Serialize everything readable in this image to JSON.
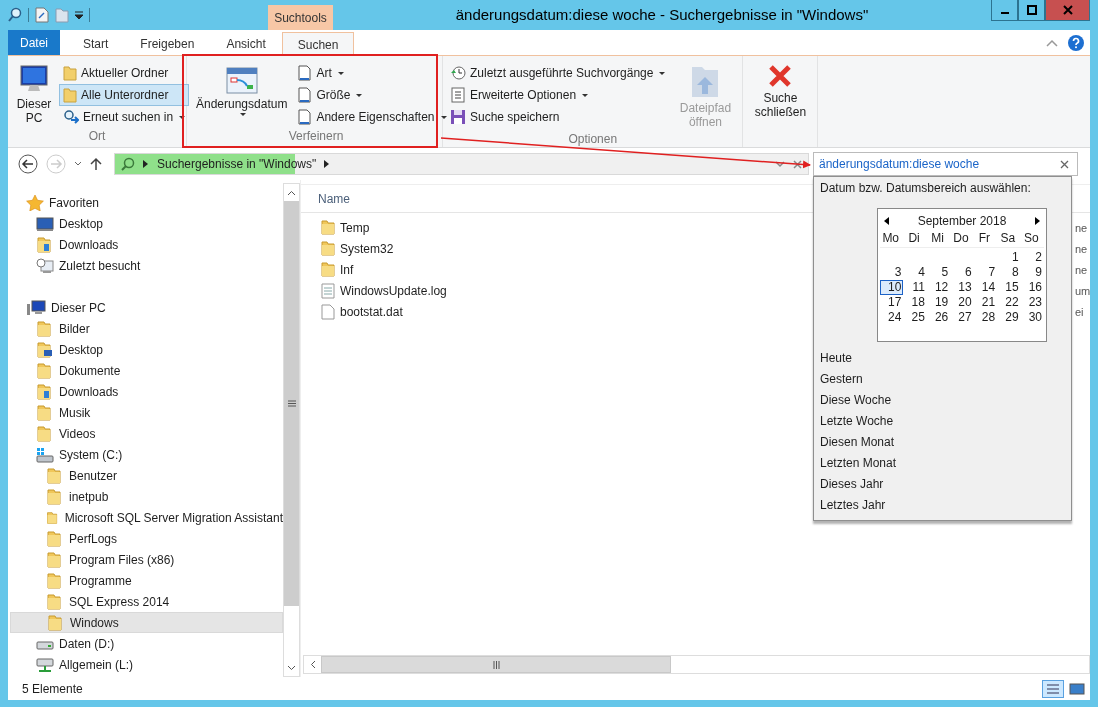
{
  "window": {
    "title": "änderungsdatum:diese woche - Suchergebnisse in \"Windows\""
  },
  "contextual_tab_group": "Suchtools",
  "ribbon_tabs": [
    {
      "label": "Datei",
      "kind": "file",
      "selected": false
    },
    {
      "label": "Start",
      "kind": "tab",
      "selected": false
    },
    {
      "label": "Freigeben",
      "kind": "tab",
      "selected": false
    },
    {
      "label": "Ansicht",
      "kind": "tab",
      "selected": false
    },
    {
      "label": "Suchen",
      "kind": "tab",
      "selected": true
    }
  ],
  "ribbon": {
    "ort": {
      "label": "Ort",
      "this_pc": "Dieser PC",
      "options": [
        {
          "label": "Aktueller Ordner",
          "selected": false
        },
        {
          "label": "Alle Unterordner",
          "selected": true
        }
      ],
      "search_again": "Erneut suchen in"
    },
    "verfeinern": {
      "label": "Verfeinern",
      "date_modified": "Änderungsdatum",
      "menus": [
        "Art",
        "Größe",
        "Andere Eigenschaften"
      ]
    },
    "optionen": {
      "label": "Optionen",
      "items": [
        {
          "label": "Zuletzt ausgeführte Suchvorgänge",
          "dropdown": true
        },
        {
          "label": "Erweiterte Optionen",
          "dropdown": true
        },
        {
          "label": "Suche speichern",
          "dropdown": false
        }
      ],
      "open_location": {
        "label": "Dateipfad öffnen",
        "disabled": true
      }
    },
    "close_search": "Suche schließen"
  },
  "address": {
    "location": "Suchergebnisse in \"Windows\"",
    "progress": {
      "level": 0.26
    }
  },
  "search": {
    "value": "änderungsdatum:diese woche"
  },
  "navigation": [
    {
      "label": "Favoriten",
      "kind": "favorites",
      "selected": false,
      "children": [
        {
          "label": "Desktop",
          "kind": "desktop",
          "selected": false
        },
        {
          "label": "Downloads",
          "kind": "downloads",
          "selected": false
        },
        {
          "label": "Zuletzt besucht",
          "kind": "recent",
          "selected": false
        }
      ]
    },
    {
      "label": "Dieser PC",
      "kind": "pc",
      "selected": false,
      "children": [
        {
          "label": "Bilder",
          "kind": "folder",
          "selected": false
        },
        {
          "label": "Desktop",
          "kind": "desktop-folder",
          "selected": false
        },
        {
          "label": "Dokumente",
          "kind": "folder",
          "selected": false
        },
        {
          "label": "Downloads",
          "kind": "downloads",
          "selected": false
        },
        {
          "label": "Musik",
          "kind": "folder",
          "selected": false
        },
        {
          "label": "Videos",
          "kind": "folder",
          "selected": false
        },
        {
          "label": "System (C:)",
          "kind": "system-drive",
          "selected": false,
          "children": [
            {
              "label": "Benutzer",
              "kind": "folder",
              "selected": false
            },
            {
              "label": "inetpub",
              "kind": "folder",
              "selected": false
            },
            {
              "label": "Microsoft SQL Server Migration Assistant",
              "kind": "folder",
              "selected": false
            },
            {
              "label": "PerfLogs",
              "kind": "folder",
              "selected": false
            },
            {
              "label": "Program Files (x86)",
              "kind": "folder",
              "selected": false
            },
            {
              "label": "Programme",
              "kind": "folder",
              "selected": false
            },
            {
              "label": "SQL Express 2014",
              "kind": "folder",
              "selected": false
            },
            {
              "label": "Windows",
              "kind": "folder",
              "selected": true
            }
          ]
        },
        {
          "label": "Daten (D:)",
          "kind": "drive",
          "selected": false
        },
        {
          "label": "Allgemein (L:)",
          "kind": "network-drive",
          "selected": false
        }
      ]
    }
  ],
  "files": {
    "column": "Name",
    "rows": [
      {
        "name": "Temp",
        "kind": "folder",
        "column_2": "ne"
      },
      {
        "name": "System32",
        "kind": "folder",
        "column_2": "ne"
      },
      {
        "name": "Inf",
        "kind": "folder",
        "column_2": "ne"
      },
      {
        "name": "WindowsUpdate.log",
        "kind": "text",
        "column_2": "um"
      },
      {
        "name": "bootstat.dat",
        "kind": "file",
        "column_2": "ei"
      }
    ]
  },
  "date_picker": {
    "prompt": "Datum bzw. Datumsbereich auswählen:",
    "month": "September 2018",
    "weekdays": [
      "Mo",
      "Di",
      "Mi",
      "Do",
      "Fr",
      "Sa",
      "So"
    ],
    "weeks": [
      [
        {
          "day": "1",
          "selected": false
        },
        {
          "day": "2",
          "selected": false
        }
      ],
      [
        {
          "day": "3",
          "selected": false
        },
        {
          "day": "4",
          "selected": false
        },
        {
          "day": "5",
          "selected": false
        },
        {
          "day": "6",
          "selected": false
        },
        {
          "day": "7",
          "selected": false
        },
        {
          "day": "8",
          "selected": false
        },
        {
          "day": "9",
          "selected": false
        }
      ],
      [
        {
          "day": "10",
          "selected": true
        },
        {
          "day": "11",
          "selected": false
        },
        {
          "day": "12",
          "selected": false
        },
        {
          "day": "13",
          "selected": false
        },
        {
          "day": "14",
          "selected": false
        },
        {
          "day": "15",
          "selected": false
        },
        {
          "day": "16",
          "selected": false
        }
      ],
      [
        {
          "day": "17",
          "selected": false
        },
        {
          "day": "18",
          "selected": false
        },
        {
          "day": "19",
          "selected": false
        },
        {
          "day": "20",
          "selected": false
        },
        {
          "day": "21",
          "selected": false
        },
        {
          "day": "22",
          "selected": false
        },
        {
          "day": "23",
          "selected": false
        }
      ],
      [
        {
          "day": "24",
          "selected": false
        },
        {
          "day": "25",
          "selected": false
        },
        {
          "day": "26",
          "selected": false
        },
        {
          "day": "27",
          "selected": false
        },
        {
          "day": "28",
          "selected": false
        },
        {
          "day": "29",
          "selected": false
        },
        {
          "day": "30",
          "selected": false
        }
      ]
    ],
    "presets": [
      "Heute",
      "Gestern",
      "Diese Woche",
      "Letzte Woche",
      "Diesen Monat",
      "Letzten Monat",
      "Dieses Jahr",
      "Letztes Jahr"
    ]
  },
  "status_bar": {
    "items_count": "5 Elemente"
  }
}
